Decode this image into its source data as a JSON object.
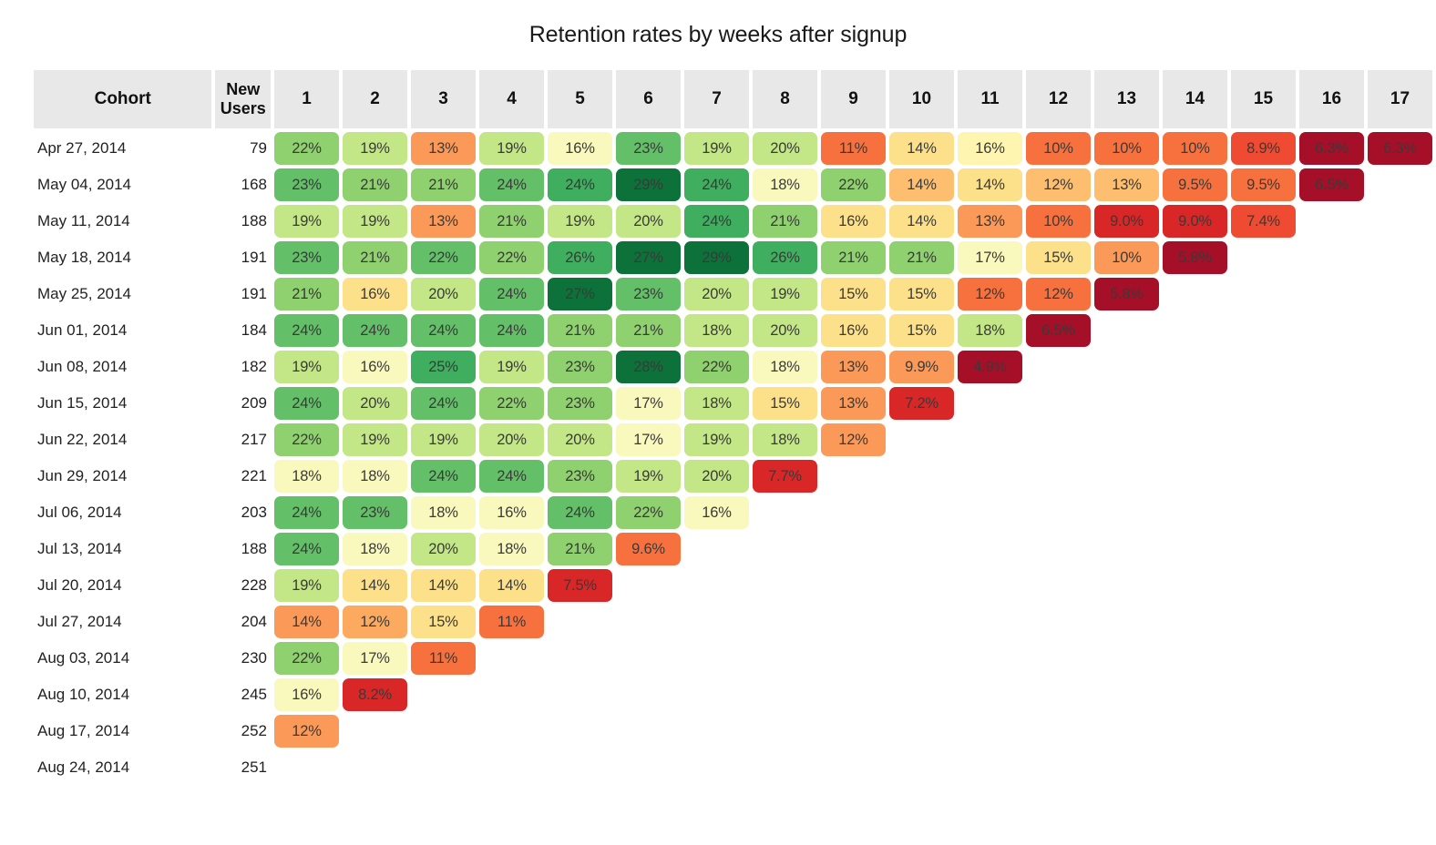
{
  "title": "Retention rates by weeks after signup",
  "header": {
    "cohort_label": "Cohort",
    "new_users_label_line1": "New",
    "new_users_label_line2": "Users",
    "week_columns": [
      "1",
      "2",
      "3",
      "4",
      "5",
      "6",
      "7",
      "8",
      "9",
      "10",
      "11",
      "12",
      "13",
      "14",
      "15",
      "16",
      "17"
    ]
  },
  "colors": {
    "header_bg": "#e8e8e8",
    "page_bg": "#ffffff",
    "title_color": "#1a1a1a",
    "scale": {
      "dark_green": "#0c7239",
      "green": "#3fae5f",
      "mid_green": "#63bf68",
      "light_green": "#8fd06f",
      "pale_green": "#c3e687",
      "pale_yellow_green": "#ddf0a0",
      "cream": "#f9f8bd",
      "pale_yellow": "#fdf5b0",
      "yellow": "#fde08a",
      "light_orange": "#fdbe6f",
      "orange": "#fb9a58",
      "deep_orange": "#f7713f",
      "red_orange": "#ef4b33",
      "red": "#d92626",
      "dark_red": "#b20f2a",
      "crimson": "#a50f28"
    }
  },
  "chart_data": {
    "type": "heatmap",
    "title": "Retention rates by weeks after signup",
    "xlabel": "Weeks after signup",
    "ylabel": "Cohort",
    "x_categories": [
      "1",
      "2",
      "3",
      "4",
      "5",
      "6",
      "7",
      "8",
      "9",
      "10",
      "11",
      "12",
      "13",
      "14",
      "15",
      "16",
      "17"
    ],
    "value_unit": "percent",
    "grid": false,
    "legend": "none",
    "rows": [
      {
        "cohort": "Apr 27, 2014",
        "new_users": "79",
        "values": [
          "22%",
          "19%",
          "13%",
          "19%",
          "16%",
          "23%",
          "19%",
          "20%",
          "11%",
          "14%",
          "16%",
          "10%",
          "10%",
          "10%",
          "8.9%",
          "6.3%",
          "6.3%"
        ]
      },
      {
        "cohort": "May 04, 2014",
        "new_users": "168",
        "values": [
          "23%",
          "21%",
          "21%",
          "24%",
          "24%",
          "29%",
          "24%",
          "18%",
          "22%",
          "14%",
          "14%",
          "12%",
          "13%",
          "9.5%",
          "9.5%",
          "6.5%"
        ]
      },
      {
        "cohort": "May 11, 2014",
        "new_users": "188",
        "values": [
          "19%",
          "19%",
          "13%",
          "21%",
          "19%",
          "20%",
          "24%",
          "21%",
          "16%",
          "14%",
          "13%",
          "10%",
          "9.0%",
          "9.0%",
          "7.4%"
        ]
      },
      {
        "cohort": "May 18, 2014",
        "new_users": "191",
        "values": [
          "23%",
          "21%",
          "22%",
          "22%",
          "26%",
          "27%",
          "29%",
          "26%",
          "21%",
          "21%",
          "17%",
          "15%",
          "10%",
          "5.8%"
        ]
      },
      {
        "cohort": "May 25, 2014",
        "new_users": "191",
        "values": [
          "21%",
          "16%",
          "20%",
          "24%",
          "27%",
          "23%",
          "20%",
          "19%",
          "15%",
          "15%",
          "12%",
          "12%",
          "5.8%"
        ]
      },
      {
        "cohort": "Jun 01, 2014",
        "new_users": "184",
        "values": [
          "24%",
          "24%",
          "24%",
          "24%",
          "21%",
          "21%",
          "18%",
          "20%",
          "16%",
          "15%",
          "18%",
          "6.5%"
        ]
      },
      {
        "cohort": "Jun 08, 2014",
        "new_users": "182",
        "values": [
          "19%",
          "16%",
          "25%",
          "19%",
          "23%",
          "28%",
          "22%",
          "18%",
          "13%",
          "9.9%",
          "4.9%"
        ]
      },
      {
        "cohort": "Jun 15, 2014",
        "new_users": "209",
        "values": [
          "24%",
          "20%",
          "24%",
          "22%",
          "23%",
          "17%",
          "18%",
          "15%",
          "13%",
          "7.2%"
        ]
      },
      {
        "cohort": "Jun 22, 2014",
        "new_users": "217",
        "values": [
          "22%",
          "19%",
          "19%",
          "20%",
          "20%",
          "17%",
          "19%",
          "18%",
          "12%"
        ]
      },
      {
        "cohort": "Jun 29, 2014",
        "new_users": "221",
        "values": [
          "18%",
          "18%",
          "24%",
          "24%",
          "23%",
          "19%",
          "20%",
          "7.7%"
        ]
      },
      {
        "cohort": "Jul 06, 2014",
        "new_users": "203",
        "values": [
          "24%",
          "23%",
          "18%",
          "16%",
          "24%",
          "22%",
          "16%"
        ]
      },
      {
        "cohort": "Jul 13, 2014",
        "new_users": "188",
        "values": [
          "24%",
          "18%",
          "20%",
          "18%",
          "21%",
          "9.6%"
        ]
      },
      {
        "cohort": "Jul 20, 2014",
        "new_users": "228",
        "values": [
          "19%",
          "14%",
          "14%",
          "14%",
          "7.5%"
        ]
      },
      {
        "cohort": "Jul 27, 2014",
        "new_users": "204",
        "values": [
          "14%",
          "12%",
          "15%",
          "11%"
        ]
      },
      {
        "cohort": "Aug 03, 2014",
        "new_users": "230",
        "values": [
          "22%",
          "17%",
          "11%"
        ]
      },
      {
        "cohort": "Aug 10, 2014",
        "new_users": "245",
        "values": [
          "16%",
          "8.2%"
        ]
      },
      {
        "cohort": "Aug 17, 2014",
        "new_users": "252",
        "values": [
          "12%"
        ]
      },
      {
        "cohort": "Aug 24, 2014",
        "new_users": "251",
        "values": []
      }
    ],
    "cell_colors": [
      [
        "#8fd06f",
        "#c3e687",
        "#fb9a58",
        "#c3e687",
        "#f9f8bd",
        "#63bf68",
        "#c3e687",
        "#c3e687",
        "#f7713f",
        "#fde08a",
        "#fdf5b0",
        "#f7713f",
        "#f7713f",
        "#f7713f",
        "#ef4b33",
        "#a50f28",
        "#a50f28"
      ],
      [
        "#63bf68",
        "#8fd06f",
        "#8fd06f",
        "#63bf68",
        "#3fae5f",
        "#0c7239",
        "#3fae5f",
        "#f9f8bd",
        "#8fd06f",
        "#fdbe6f",
        "#fde08a",
        "#fdbe6f",
        "#fdbe6f",
        "#f7713f",
        "#f7713f",
        "#a50f28"
      ],
      [
        "#c3e687",
        "#c3e687",
        "#fb9a58",
        "#8fd06f",
        "#c3e687",
        "#c3e687",
        "#3fae5f",
        "#8fd06f",
        "#fde08a",
        "#fde08a",
        "#fb9a58",
        "#f7713f",
        "#d92626",
        "#d92626",
        "#ef4b33"
      ],
      [
        "#63bf68",
        "#8fd06f",
        "#63bf68",
        "#8fd06f",
        "#3fae5f",
        "#0c7239",
        "#0c7239",
        "#3fae5f",
        "#8fd06f",
        "#8fd06f",
        "#f9f8bd",
        "#fde08a",
        "#fb9a58",
        "#a50f28"
      ],
      [
        "#8fd06f",
        "#fde08a",
        "#c3e687",
        "#63bf68",
        "#0c7239",
        "#63bf68",
        "#c3e687",
        "#c3e687",
        "#fde08a",
        "#fde08a",
        "#f7713f",
        "#f7713f",
        "#a50f28"
      ],
      [
        "#63bf68",
        "#63bf68",
        "#63bf68",
        "#63bf68",
        "#8fd06f",
        "#8fd06f",
        "#c3e687",
        "#c3e687",
        "#fde08a",
        "#fde08a",
        "#c3e687",
        "#a50f28"
      ],
      [
        "#c3e687",
        "#f9f8bd",
        "#3fae5f",
        "#c3e687",
        "#8fd06f",
        "#0c7239",
        "#8fd06f",
        "#f9f8bd",
        "#fb9a58",
        "#fb9a58",
        "#a50f28"
      ],
      [
        "#63bf68",
        "#c3e687",
        "#63bf68",
        "#8fd06f",
        "#8fd06f",
        "#f9f8bd",
        "#c3e687",
        "#fde08a",
        "#fb9a58",
        "#d92626"
      ],
      [
        "#8fd06f",
        "#c3e687",
        "#c3e687",
        "#c3e687",
        "#c3e687",
        "#f9f8bd",
        "#c3e687",
        "#c3e687",
        "#fb9a58"
      ],
      [
        "#f9f8bd",
        "#f9f8bd",
        "#63bf68",
        "#63bf68",
        "#8fd06f",
        "#c3e687",
        "#c3e687",
        "#d92626"
      ],
      [
        "#63bf68",
        "#63bf68",
        "#f9f8bd",
        "#f9f8bd",
        "#63bf68",
        "#8fd06f",
        "#f9f8bd"
      ],
      [
        "#63bf68",
        "#f9f8bd",
        "#c3e687",
        "#f9f8bd",
        "#8fd06f",
        "#f7713f"
      ],
      [
        "#c3e687",
        "#fde08a",
        "#fde08a",
        "#fde08a",
        "#d92626"
      ],
      [
        "#fb9a58",
        "#fbaa60",
        "#fde08a",
        "#f7713f"
      ],
      [
        "#8fd06f",
        "#f9f8bd",
        "#f7713f"
      ],
      [
        "#f9f8bd",
        "#d92626"
      ],
      [
        "#fb9a58"
      ],
      []
    ]
  }
}
